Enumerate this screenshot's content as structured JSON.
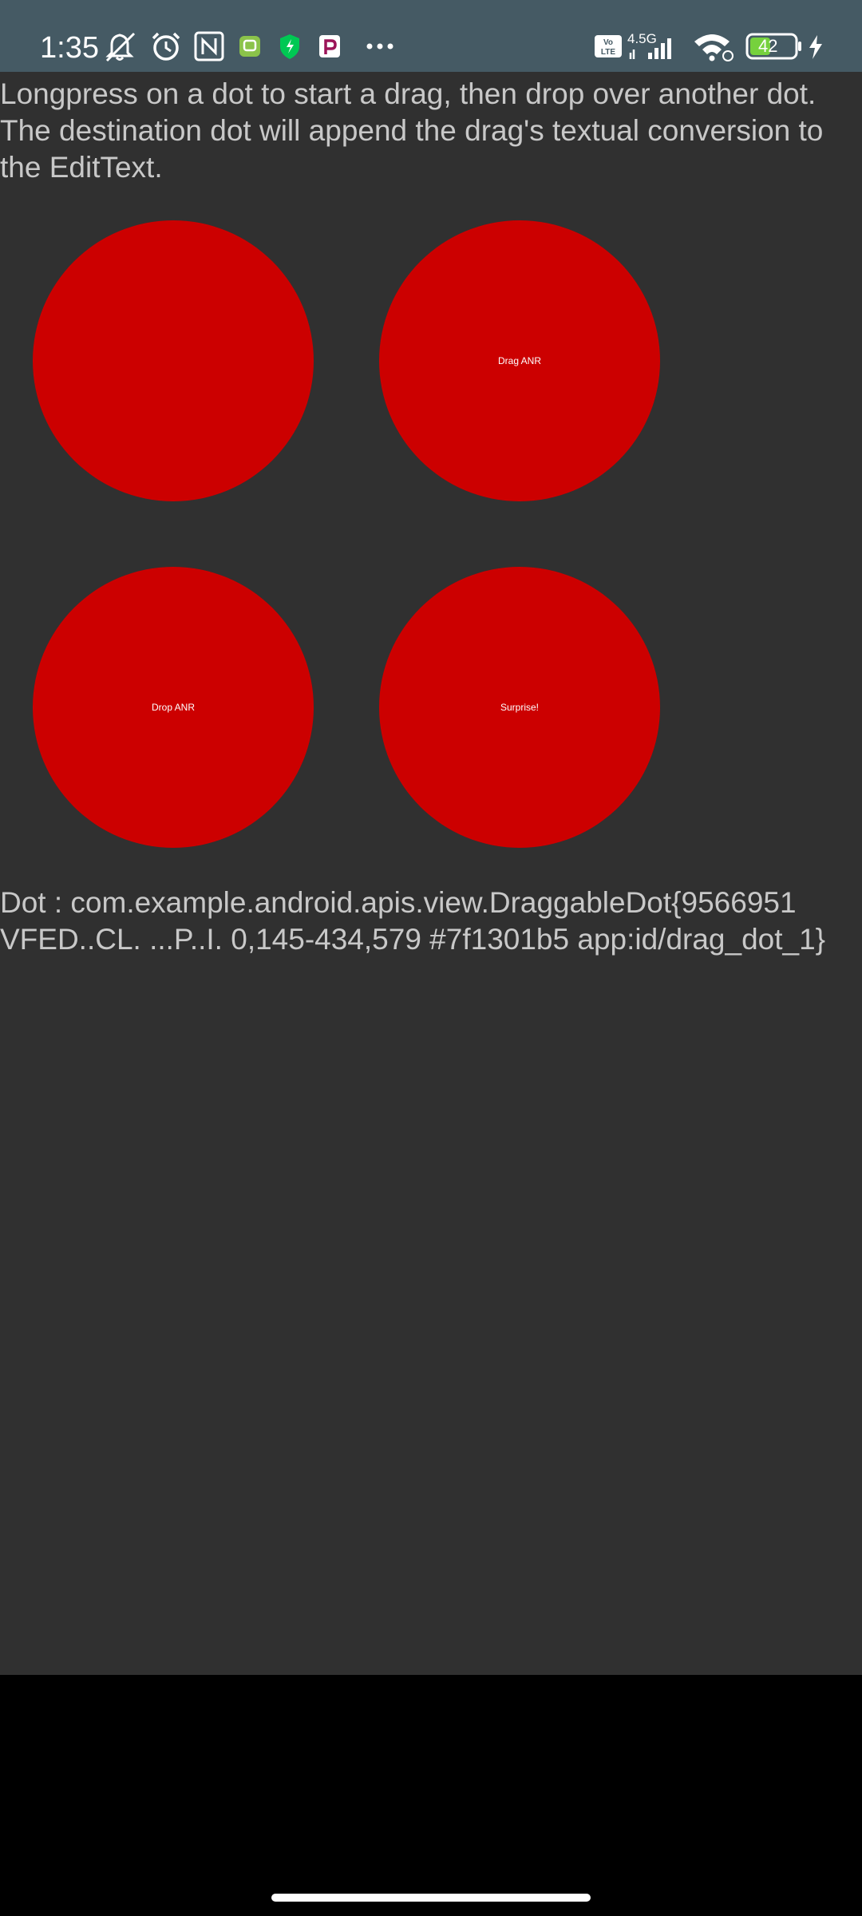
{
  "status_bar": {
    "time": "1:35",
    "network_type": "4.5G",
    "volte_label": "Vo LTE",
    "battery_level": "42",
    "icons": [
      "mute-icon",
      "alarm-icon",
      "nfc-icon",
      "app-notification-icon",
      "vpn-shield-icon",
      "parking-app-icon",
      "more-notifications-icon",
      "volte-icon",
      "signal-icon",
      "wifi-icon",
      "battery-icon",
      "charging-icon"
    ],
    "background_color": "#455a64"
  },
  "app": {
    "instructions": "Longpress on a dot to start a drag, then drop over another dot. The destination dot will append the drag's textual conversion to the EditText.",
    "dots": [
      {
        "label": ""
      },
      {
        "label": "Drag ANR"
      },
      {
        "label": "Drop ANR"
      },
      {
        "label": "Surprise!"
      }
    ],
    "dot_color": "#cc0000",
    "result_lines": [
      "Dot : com.example.android.apis.view.DraggableDot{9566951",
      "VFED..CL. ...P..I. 0,145-434,579 #7f1301b5 app:id/drag_dot_1}"
    ],
    "background_color": "#303030",
    "text_color": "#c8c8c8"
  }
}
